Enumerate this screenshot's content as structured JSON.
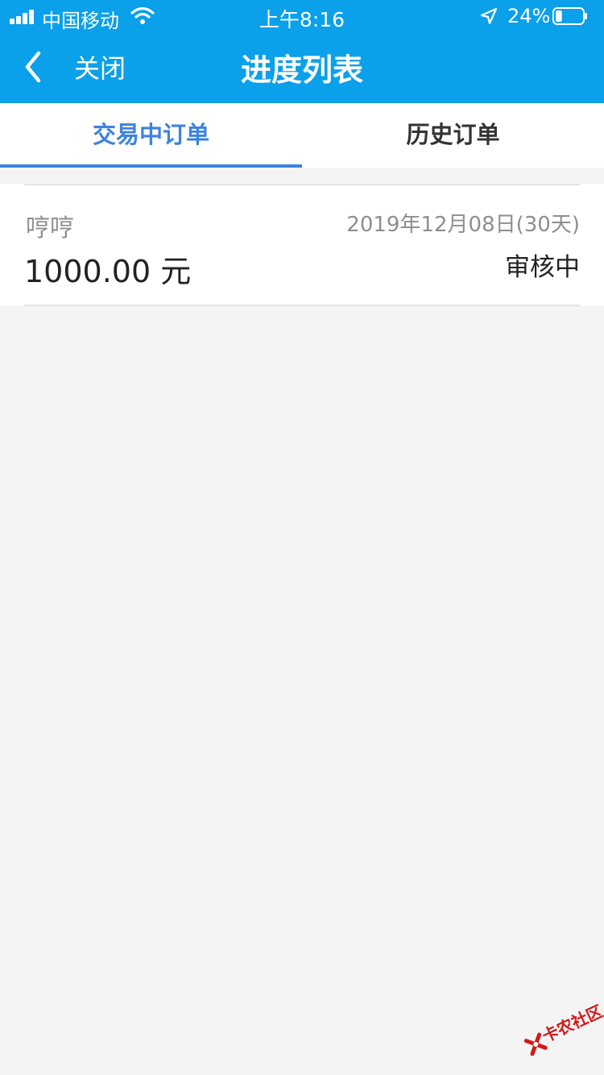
{
  "status_bar": {
    "carrier": "中国移动",
    "time": "上午8:16",
    "battery_percent": "24%",
    "battery_level": 0.24
  },
  "nav": {
    "back_label": "关闭",
    "title": "进度列表"
  },
  "tabs": [
    {
      "label": "交易中订单",
      "active": true
    },
    {
      "label": "历史订单",
      "active": false
    }
  ],
  "orders": [
    {
      "name": "哼哼",
      "amount": "1000.00 元",
      "date": "2019年12月08日(30天)",
      "status": "审核中"
    }
  ],
  "watermark": {
    "text": "卡农社区"
  },
  "colors": {
    "header": "#0aa0ea",
    "tab_active": "#3d82e0",
    "background": "#f4f4f4",
    "watermark": "#d11a1a"
  }
}
